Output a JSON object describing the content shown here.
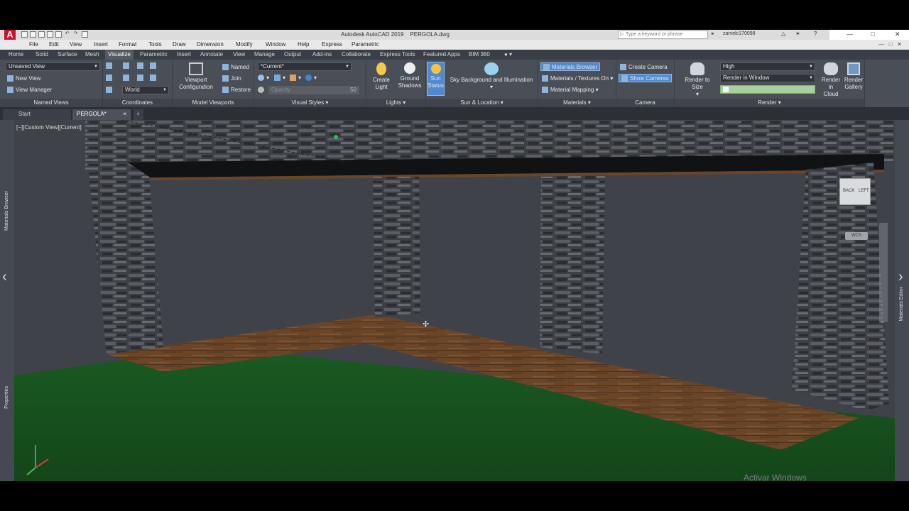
{
  "title_bar": {
    "app_title": "Autodesk AutoCAD 2019",
    "file_name": "PERGOLA.dwg",
    "search_placeholder": "Type a keyword or phrase",
    "user": "zarvelc170098"
  },
  "menu": [
    "File",
    "Edit",
    "View",
    "Insert",
    "Format",
    "Tools",
    "Draw",
    "Dimension",
    "Modify",
    "Window",
    "Help",
    "Express",
    "Parametric"
  ],
  "ribbon_tabs": [
    "Home",
    "Solid",
    "Surface",
    "Mesh",
    "Visualize",
    "Parametric",
    "Insert",
    "Annotate",
    "View",
    "Manage",
    "Output",
    "Add-ins",
    "Collaborate",
    "Express Tools",
    "Featured Apps",
    "BIM 360"
  ],
  "active_ribbon_tab": "Visualize",
  "panels": {
    "named_views": {
      "title": "Named Views",
      "view_select": "Unsaved View",
      "new_view": "New View",
      "view_manager": "View Manager"
    },
    "coordinates": {
      "title": "Coordinates",
      "ucs_select": "World"
    },
    "model_viewports": {
      "title": "Model Viewports",
      "viewport_config_line1": "Viewport",
      "viewport_config_line2": "Configuration",
      "named": "Named",
      "join": "Join",
      "restore": "Restore"
    },
    "visual_styles": {
      "title": "Visual Styles",
      "style_select": "*Current*",
      "opacity_label": "Opacity",
      "opacity_value": "50"
    },
    "lights": {
      "title": "Lights",
      "create_light_1": "Create",
      "create_light_2": "Light",
      "ground_shadows_1": "Ground",
      "ground_shadows_2": "Shadows"
    },
    "sun_location": {
      "title": "Sun & Location",
      "sun_status_1": "Sun",
      "sun_status_2": "Status",
      "sky_bg": "Sky Background and Illumination"
    },
    "materials": {
      "title": "Materials",
      "materials_browser": "Materials Browser",
      "materials_textures": "Materials / Textures On",
      "material_mapping": "Material Mapping"
    },
    "camera": {
      "title": "Camera",
      "create_camera": "Create Camera",
      "show_cameras": "Show Cameras"
    },
    "render": {
      "title": "Render",
      "render_to_size": "Render to Size",
      "quality": "High",
      "render_in": "Render in Window",
      "render_cloud_1": "Render in",
      "render_cloud_2": "Cloud",
      "render_gallery_1": "Render",
      "render_gallery_2": "Gallery"
    }
  },
  "doc_tabs": [
    "Start",
    "PERGOLA*"
  ],
  "viewport": {
    "label": "[−][Custom View][Current]",
    "viewcube_back": "BACK",
    "viewcube_left": "LEFT",
    "wcs": "WCS",
    "watermark": "Activar Windows"
  },
  "palettes": {
    "left_top": "Materials Browser",
    "left_bottom": "Properties",
    "right": "Materials Editor"
  },
  "colors": {
    "ribbon": "#4a4f57",
    "viewport_bg": "#40444a",
    "grass": "#1e5a21",
    "wood": "#6b4528",
    "stone": "#3c3f44",
    "accent": "#4f8ad1"
  }
}
